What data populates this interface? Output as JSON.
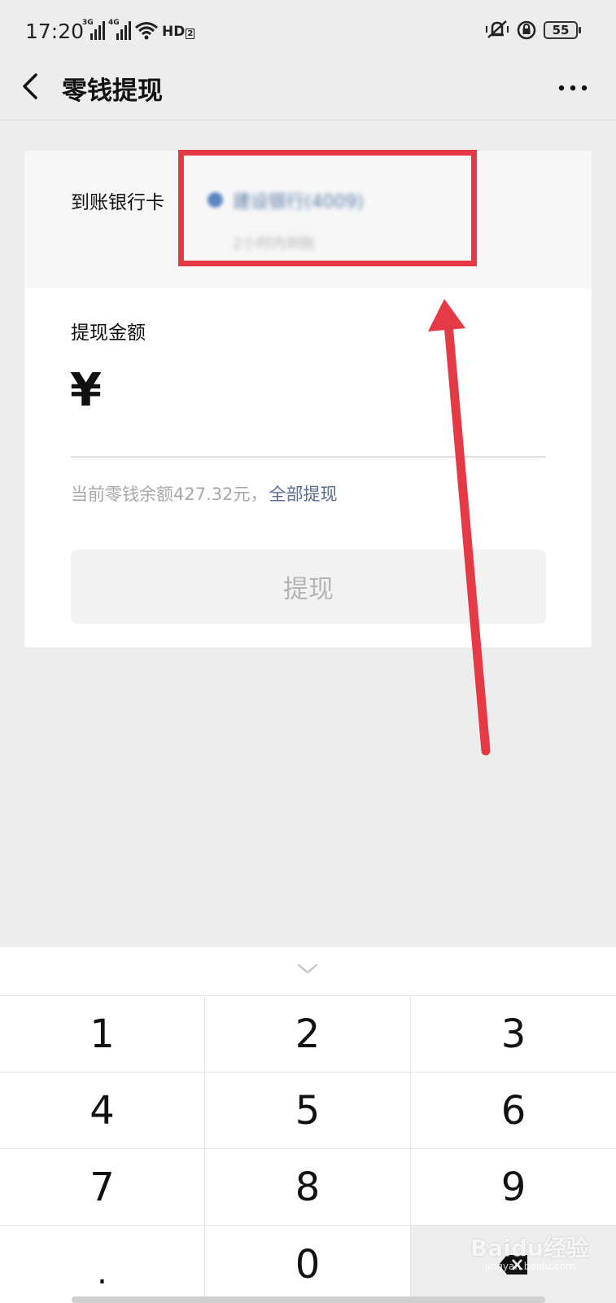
{
  "status_bar": {
    "time": "17:20",
    "signal1_tag": "3G",
    "signal2_tag": "4G",
    "hd_label": "HD",
    "hd_sub": "2",
    "battery_level": "55"
  },
  "nav": {
    "title": "零钱提现"
  },
  "bank_card": {
    "label": "到账银行卡",
    "bank_name": "建设银行(4009)",
    "arrival_note": "2小时内到账"
  },
  "amount": {
    "label": "提现金额",
    "currency_symbol": "¥",
    "value": ""
  },
  "balance": {
    "text": "当前零钱余额427.32元，",
    "withdraw_all_label": "全部提现"
  },
  "withdraw_button": {
    "label": "提现"
  },
  "keyboard": {
    "keys": [
      "1",
      "2",
      "3",
      "4",
      "5",
      "6",
      "7",
      "8",
      "9",
      ".",
      "0"
    ]
  },
  "watermark": {
    "text": "Baidu经验",
    "sub": "jingyan.baidu.com"
  },
  "colors": {
    "accent_link": "#576b95",
    "annotation_red": "#e63946",
    "background": "#ededed"
  }
}
